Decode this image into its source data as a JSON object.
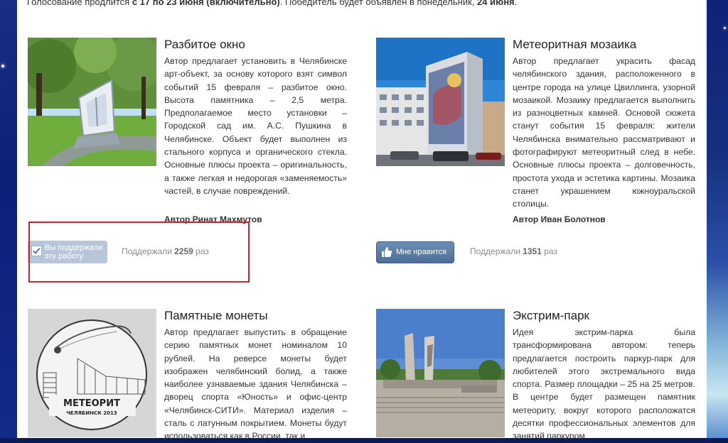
{
  "intro": {
    "prefix": "Голосование продлится ",
    "dates": "с 17 по 23 июня (включительно)",
    "middle": ". Победитель будет объявлен в понедельник, ",
    "announce_day": "24 июня",
    "suffix": "."
  },
  "projects": [
    {
      "title": "Разбитое окно",
      "description": "Автор предлагает установить в Челябинске арт-объект, за основу которого взят символ событий 15 февраля – разбитое окно. Высота памятника – 2,5 метра. Предполагаемое место установки – Городской сад им. А.С. Пушкина в Челябинске. Объект будет выполнен из стального корпуса и органического стекла. Основные плюсы проекта – оригинальность, а также легкая и недорогая «заменяемость» частей, в случае повреждений.",
      "author": "Автор Ринат Махмутов",
      "vote_button": "Вы поддержали эту работу",
      "support_prefix": "Поддержали ",
      "support_count": "2259",
      "support_suffix": " раз"
    },
    {
      "title": "Метеоритная мозаика",
      "description": "Автор предлагает украсить фасад челябинского здания, расположенного в центре города на улице Цвиллинга, узорной мозаикой. Мозаику предлагается выполнить из разноцветных камней. Основой сюжета станут события 15 февраля: жители Челябинска внимательно рассматривают и фотографируют метеоритный след в небе. Основные плюсы проекта – долговечность, простота ухода и эстетика картины. Мозаика станет украшением южноуральской столицы.",
      "author": "Автор Иван Болотнов",
      "vote_button": "Мне нравится",
      "support_prefix": "Поддержали ",
      "support_count": "1351",
      "support_suffix": " раз"
    },
    {
      "title": "Памятные монеты",
      "description": "Автор предлагает выпустить в обращение серию памятных монет номиналом 10 рублей. На реверсе монеты будет изображен челябинский болид, а также наиболее узнаваемые здания Челябинска – дворец спорта «Юность» и офис-центр «Челябинск-СИТИ». Материал изделия – сталь с латунным покрытием. Монеты будут использоваться как в России, так и",
      "coin_text": "МЕТЕОРИТ",
      "coin_subtext": "ЧЕЛЯБИНСК 2013"
    },
    {
      "title": "Экстрим-парк",
      "description": "Идея экстрим-парка была трансформирована автором: теперь предлагается построить паркур-парк для любителей этого экстремального вида спорта. Размер площадки – 25 на 25 метров. В центре будет размещен памятник метеориту, вокруг которого расположатся десятки профессиональных элементов для занятий паркуром."
    }
  ],
  "colors": {
    "accent_blue": "#5676a0",
    "voted_button": "#b7c6d8",
    "highlight_border": "#d0202a"
  }
}
